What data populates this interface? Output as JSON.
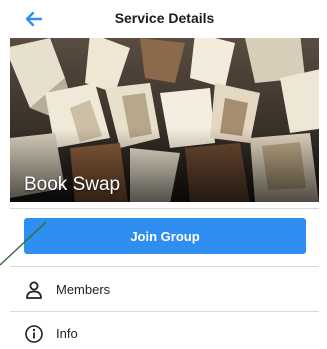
{
  "header": {
    "title": "Service Details",
    "back_icon": "arrow-left-icon"
  },
  "hero": {
    "title": "Book Swap"
  },
  "join_button": {
    "label": "Join Group"
  },
  "menu": [
    {
      "label": "Members",
      "icon": "person-icon"
    },
    {
      "label": "Info",
      "icon": "info-circle-icon"
    }
  ],
  "colors": {
    "accent": "#2f8ff0",
    "back_arrow": "#2f8ff0",
    "pointer": "#3b6b3b"
  }
}
